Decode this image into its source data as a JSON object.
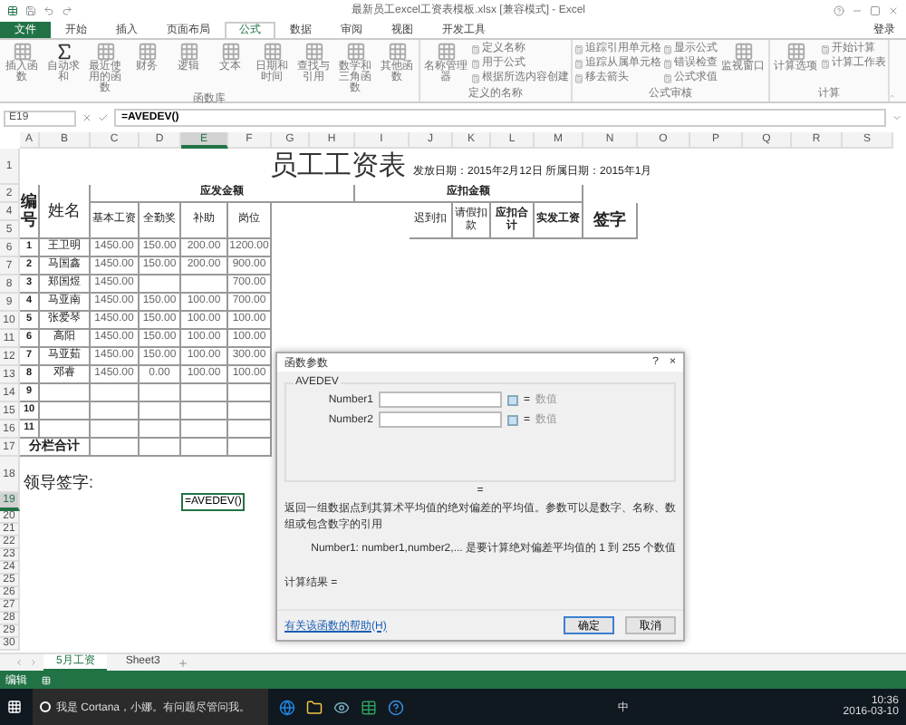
{
  "window": {
    "title": "最新员工excel工资表模板.xlsx [兼容模式] - Excel",
    "sign_in": "登录"
  },
  "ribbon_tabs": [
    {
      "label": "文件",
      "selected": false
    },
    {
      "label": "开始",
      "selected": false
    },
    {
      "label": "插入",
      "selected": false
    },
    {
      "label": "页面布局",
      "selected": false
    },
    {
      "label": "公式",
      "selected": true
    },
    {
      "label": "数据",
      "selected": false
    },
    {
      "label": "审阅",
      "selected": false
    },
    {
      "label": "视图",
      "selected": false
    },
    {
      "label": "开发工具",
      "selected": false
    }
  ],
  "ribbon_groups": [
    {
      "title": "函数库",
      "buttons": [
        {
          "label": "插入函数",
          "kind": "large"
        },
        {
          "label": "自动求和",
          "kind": "large"
        },
        {
          "label": "最近使用的函数",
          "kind": "large"
        },
        {
          "label": "财务",
          "kind": "large"
        },
        {
          "label": "逻辑",
          "kind": "large"
        },
        {
          "label": "文本",
          "kind": "large"
        },
        {
          "label": "日期和时间",
          "kind": "large"
        },
        {
          "label": "查找与引用",
          "kind": "large"
        },
        {
          "label": "数学和三角函数",
          "kind": "large"
        },
        {
          "label": "其他函数",
          "kind": "large"
        }
      ]
    },
    {
      "title": "定义的名称",
      "buttons": [
        {
          "label": "名称管理器",
          "kind": "large"
        },
        {
          "label": "定义名称",
          "kind": "small"
        },
        {
          "label": "用于公式",
          "kind": "small"
        },
        {
          "label": "根据所选内容创建",
          "kind": "small"
        }
      ]
    },
    {
      "title": "公式审核",
      "buttons": [
        {
          "label": "追踪引用单元格",
          "kind": "small"
        },
        {
          "label": "追踪从属单元格",
          "kind": "small"
        },
        {
          "label": "移去箭头",
          "kind": "small"
        },
        {
          "label": "显示公式",
          "kind": "small"
        },
        {
          "label": "错误检查",
          "kind": "small"
        },
        {
          "label": "公式求值",
          "kind": "small"
        },
        {
          "label": "监视窗口",
          "kind": "large"
        }
      ]
    },
    {
      "title": "计算",
      "buttons": [
        {
          "label": "计算选项",
          "kind": "large"
        },
        {
          "label": "开始计算",
          "kind": "small"
        },
        {
          "label": "计算工作表",
          "kind": "small"
        }
      ]
    }
  ],
  "formula_bar": {
    "name_box": "E19",
    "formula": "=AVEDEV()"
  },
  "columns": [
    {
      "label": "A",
      "selected": false
    },
    {
      "label": "B",
      "selected": false
    },
    {
      "label": "C",
      "selected": false
    },
    {
      "label": "D",
      "selected": false
    },
    {
      "label": "E",
      "selected": true
    },
    {
      "label": "F",
      "selected": false
    },
    {
      "label": "G",
      "selected": false
    },
    {
      "label": "H",
      "selected": false
    },
    {
      "label": "I",
      "selected": false
    },
    {
      "label": "J",
      "selected": false
    },
    {
      "label": "K",
      "selected": false
    },
    {
      "label": "L",
      "selected": false
    },
    {
      "label": "M",
      "selected": false
    },
    {
      "label": "N",
      "selected": false
    },
    {
      "label": "O",
      "selected": false
    },
    {
      "label": "P",
      "selected": false
    },
    {
      "label": "Q",
      "selected": false
    },
    {
      "label": "R",
      "selected": false
    },
    {
      "label": "S",
      "selected": false
    }
  ],
  "rows": [
    {
      "label": "1",
      "selected": false
    },
    {
      "label": "2",
      "selected": false
    },
    {
      "label": "4",
      "selected": false
    },
    {
      "label": "5",
      "selected": false
    },
    {
      "label": "6",
      "selected": false
    },
    {
      "label": "7",
      "selected": false
    },
    {
      "label": "8",
      "selected": false
    },
    {
      "label": "9",
      "selected": false
    },
    {
      "label": "10",
      "selected": false
    },
    {
      "label": "11",
      "selected": false
    },
    {
      "label": "12",
      "selected": false
    },
    {
      "label": "13",
      "selected": false
    },
    {
      "label": "14",
      "selected": false
    },
    {
      "label": "15",
      "selected": false
    },
    {
      "label": "16",
      "selected": false
    },
    {
      "label": "17",
      "selected": false
    },
    {
      "label": "18",
      "selected": false
    },
    {
      "label": "19",
      "selected": true
    },
    {
      "label": "20",
      "selected": false
    },
    {
      "label": "21",
      "selected": false
    },
    {
      "label": "22",
      "selected": false
    },
    {
      "label": "23",
      "selected": false
    },
    {
      "label": "24",
      "selected": false
    },
    {
      "label": "25",
      "selected": false
    },
    {
      "label": "26",
      "selected": false
    },
    {
      "label": "27",
      "selected": false
    },
    {
      "label": "28",
      "selected": false
    },
    {
      "label": "29",
      "selected": false
    },
    {
      "label": "30",
      "selected": false
    }
  ],
  "sheet": {
    "title": "员工工资表",
    "date_note": "发放日期：2015年2月12日  所属日期：2015年1月",
    "header_groups": [
      "应发金额",
      "应扣金额"
    ],
    "left_headers": [
      "编号",
      "姓名"
    ],
    "pay_headers": [
      "基本工资",
      "全勤奖",
      "补助",
      "岗位"
    ],
    "deduct_headers": [
      "迟到扣",
      "请假扣款",
      "应扣合计",
      "实发工资",
      "签字"
    ],
    "records": [
      {
        "no": "1",
        "name": "王卫明",
        "cells": [
          "1450.00",
          "150.00",
          "200.00",
          "1200.00"
        ]
      },
      {
        "no": "2",
        "name": "马国鑫",
        "cells": [
          "1450.00",
          "150.00",
          "200.00",
          "900.00"
        ]
      },
      {
        "no": "3",
        "name": "郑国煜",
        "cells": [
          "1450.00",
          null,
          null,
          "700.00"
        ]
      },
      {
        "no": "4",
        "name": "马亚南",
        "cells": [
          "1450.00",
          "150.00",
          "100.00",
          "700.00"
        ]
      },
      {
        "no": "5",
        "name": "张爱琴",
        "cells": [
          "1450.00",
          "150.00",
          "100.00",
          "100.00"
        ]
      },
      {
        "no": "6",
        "name": "高阳",
        "cells": [
          "1450.00",
          "150.00",
          "100.00",
          "100.00"
        ]
      },
      {
        "no": "7",
        "name": "马亚茹",
        "cells": [
          "1450.00",
          "150.00",
          "100.00",
          "300.00"
        ]
      },
      {
        "no": "8",
        "name": "邓睿",
        "cells": [
          "1450.00",
          "0.00",
          "100.00",
          "100.00"
        ]
      },
      {
        "no": "9"
      },
      {
        "no": "10"
      },
      {
        "no": "11"
      }
    ],
    "subtotal_label": "分栏合计",
    "signature_label": "领导签字:",
    "active_cell": "=AVEDEV()"
  },
  "dialog": {
    "title": "函数参数",
    "help": "?",
    "close": "×",
    "function": "AVEDEV",
    "args": [
      {
        "label": "Number1",
        "equals": "=",
        "result": "数值"
      },
      {
        "label": "Number2",
        "equals": "=",
        "result": "数值"
      }
    ],
    "equals": "=",
    "description": "返回一组数据点到其算术平均值的绝对偏差的平均值。参数可以是数字、名称、数组或包含数字的引用",
    "arg_help": "Number1:  number1,number2,... 是要计算绝对偏差平均值的 1 到 255 个数值",
    "result": "计算结果 =",
    "link": "有关该函数的帮助(H)",
    "buttons": [
      {
        "label": "确定",
        "kind": "primary"
      },
      {
        "label": "取消",
        "kind": "normal"
      }
    ]
  },
  "sheet_tabs": [
    {
      "label": "5月工资",
      "selected": true
    },
    {
      "label": "Sheet3",
      "selected": false
    }
  ],
  "status_bar": {
    "mode": "编辑"
  },
  "taskbar": {
    "search": "我是 Cortana，小娜。有问题尽管问我。",
    "ime": "中",
    "time": "10:36",
    "date": "2016-03-10"
  }
}
